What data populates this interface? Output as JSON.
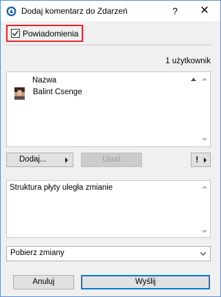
{
  "window": {
    "title": "Dodaj komentarz do Zdarzeń",
    "help_label": "?",
    "close_label": "✕"
  },
  "notifications": {
    "label": "Powiadomienia",
    "checked": true
  },
  "user_count": "1 użytkownik",
  "list": {
    "column_header": "Nazwa",
    "rows": [
      {
        "name": "Balint Csenge"
      }
    ]
  },
  "buttons": {
    "add": "Dodaj...",
    "remove": "Usuń",
    "priority": "!",
    "cancel": "Anuluj",
    "send": "Wyślij"
  },
  "comment": {
    "text": "Struktura płyty uległa zmianie"
  },
  "select": {
    "value": "Pobierz zmiany"
  },
  "colors": {
    "highlight_border": "#e5202a",
    "default_button_border": "#0078d7",
    "window_border": "#5b8fcf"
  }
}
